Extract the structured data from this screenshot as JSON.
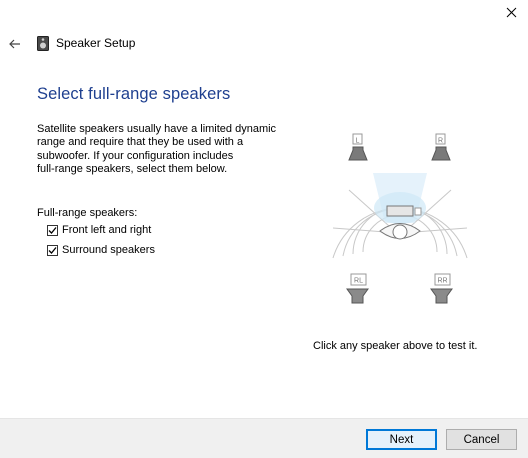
{
  "window": {
    "title": "Speaker Setup",
    "back_icon": "back-arrow-icon",
    "close_icon": "close-icon"
  },
  "page": {
    "heading": "Select full-range speakers",
    "description_lines": [
      "Satellite speakers usually have a limited dynamic",
      "range and require that they be used with a",
      "subwoofer.  If your configuration includes",
      "full-range speakers, select them below."
    ],
    "full_range_label": "Full-range speakers:",
    "options": [
      {
        "label": "Front left and right",
        "checked": true
      },
      {
        "label": "Surround speakers",
        "checked": true
      }
    ],
    "speakers": {
      "front_left": "L",
      "front_right": "R",
      "rear_left": "RL",
      "rear_right": "RR"
    },
    "hint": "Click any speaker above to test it."
  },
  "footer": {
    "next_label": "Next",
    "cancel_label": "Cancel"
  },
  "colors": {
    "heading": "#1e3f8f",
    "footer_bg": "#f0f0f0",
    "focus": "#0078d7",
    "sound_wave": "#cfe8f7"
  }
}
